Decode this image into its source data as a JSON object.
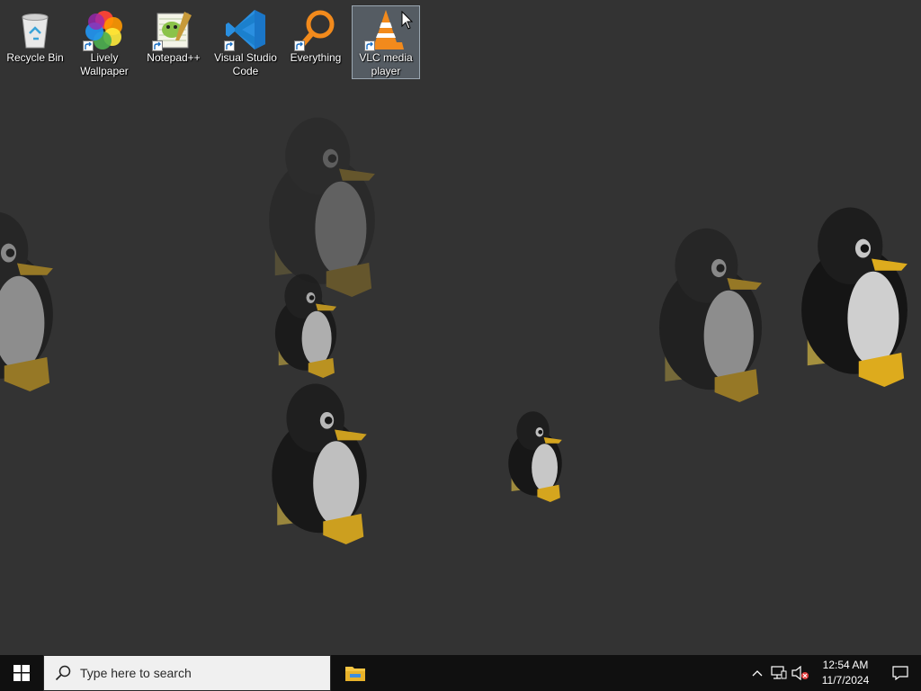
{
  "desktop": {
    "icons": [
      {
        "label": "Recycle Bin",
        "icon": "recycle-bin-icon",
        "shortcut": false
      },
      {
        "label": "Lively Wallpaper",
        "icon": "lively-wallpaper-icon",
        "shortcut": true
      },
      {
        "label": "Notepad++",
        "icon": "notepad-plus-plus-icon",
        "shortcut": true
      },
      {
        "label": "Visual Studio Code",
        "icon": "vscode-icon",
        "shortcut": true
      },
      {
        "label": "Everything",
        "icon": "everything-search-icon",
        "shortcut": true
      },
      {
        "label": "VLC media player",
        "icon": "vlc-icon",
        "shortcut": true,
        "selected": true
      }
    ],
    "wallpaper": "penguin-wallpaper"
  },
  "taskbar": {
    "search_placeholder": "Type here to search",
    "pinned": [
      {
        "name": "File Explorer",
        "icon": "file-explorer-icon"
      }
    ],
    "tray": {
      "icons": [
        "chevron-up-icon",
        "network-icon",
        "volume-muted-icon"
      ],
      "time": "12:54 AM",
      "date": "11/7/2024"
    }
  },
  "colors": {
    "desktop_bg": "#333333",
    "taskbar_bg": "#101010",
    "search_bg": "#f0f0f0",
    "vscode_blue": "#2a8fe0",
    "vlc_orange": "#f28a1c"
  }
}
